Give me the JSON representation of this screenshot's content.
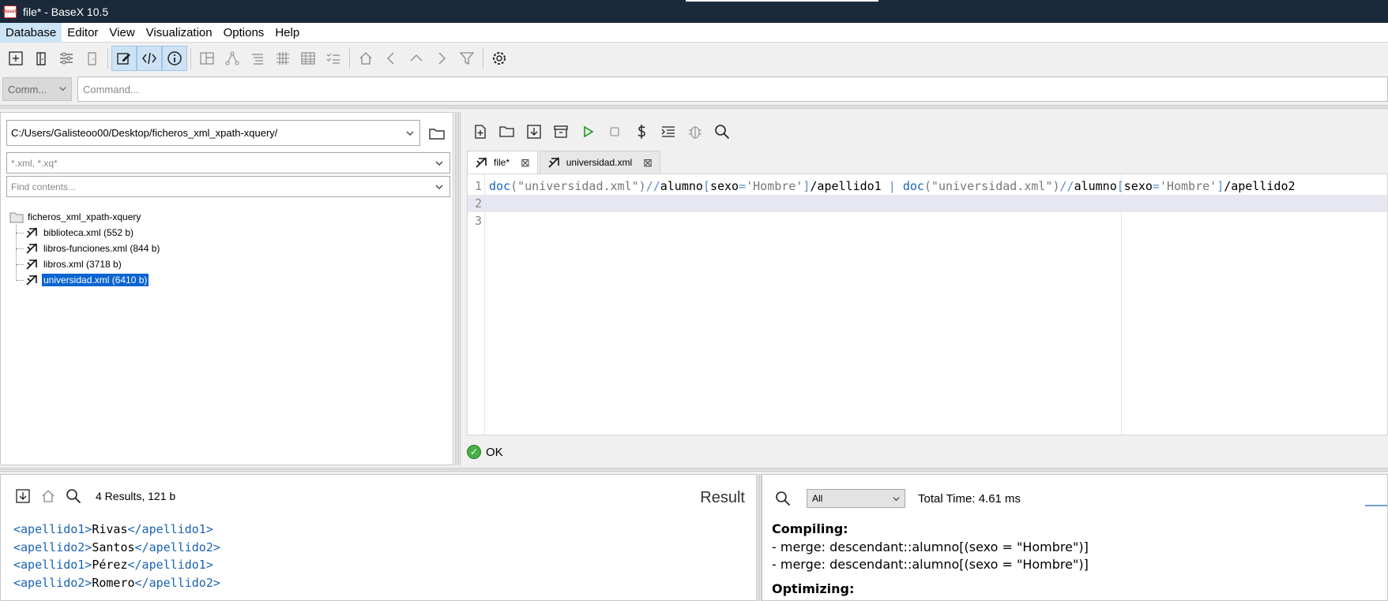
{
  "window": {
    "title": "file* - BaseX 10.5",
    "logo_text": "BaseX"
  },
  "menu": [
    "Database",
    "Editor",
    "View",
    "Visualization",
    "Options",
    "Help"
  ],
  "command": {
    "mode": "Comm...",
    "placeholder": "Command..."
  },
  "project": {
    "path": "C:/Users/Galisteoo00/Desktop/ficheros_xml_xpath-xquery/",
    "filter_placeholder": "*.xml, *.xq*",
    "contents_placeholder": "Find contents...",
    "root": "ficheros_xml_xpath-xquery",
    "files": [
      {
        "label": "biblioteca.xml (552 b)"
      },
      {
        "label": "libros-funciones.xml (844 b)"
      },
      {
        "label": "libros.xml (3718 b)"
      },
      {
        "label": "universidad.xml (6410 b)",
        "selected": true
      }
    ]
  },
  "editor": {
    "tabs": [
      {
        "label": "file*",
        "active": true
      },
      {
        "label": "universidad.xml",
        "active": false
      }
    ],
    "line_numbers": [
      "1",
      "2",
      "3"
    ],
    "code": {
      "doc1": "doc",
      "str1": "(\"universidad.xml\")",
      "slash1": "//",
      "elem1": "alumno",
      "pred1": "[",
      "field1": "sexo",
      "eq1": "=",
      "val1": "'Hombre'",
      "close1": "]",
      "path1": "/apellido1",
      "union": " | ",
      "doc2": "doc",
      "str2": "(\"universidad.xml\")",
      "slash2": "//",
      "elem2": "alumno",
      "pred2": "[",
      "field2": "sexo",
      "eq2": "=",
      "val2": "'Hombre'",
      "close2": "]",
      "path2": "/apellido2"
    },
    "status": "OK"
  },
  "result": {
    "count": "4 Results, 121 b",
    "title": "Result",
    "lines": [
      {
        "open": "<apellido1>",
        "text": "Rivas",
        "close": "</apellido1>"
      },
      {
        "open": "<apellido2>",
        "text": "Santos",
        "close": "</apellido2>"
      },
      {
        "open": "<apellido1>",
        "text": "Pérez",
        "close": "</apellido1>"
      },
      {
        "open": "<apellido2>",
        "text": "Romero",
        "close": "</apellido2>"
      }
    ]
  },
  "info": {
    "filter": "All",
    "total_time": "Total Time: 4.61 ms",
    "compiling_head": "Compiling:",
    "compiling_lines": [
      "- merge: descendant::alumno[(sexo = \"Hombre\")]",
      "- merge: descendant::alumno[(sexo = \"Hombre\")]"
    ],
    "optimizing_head": "Optimizing:"
  },
  "colors": {
    "accent": "#0a64d0",
    "titlebar": "#1b2a3a",
    "keyword": "#1a63b3",
    "ok": "#45b045"
  }
}
